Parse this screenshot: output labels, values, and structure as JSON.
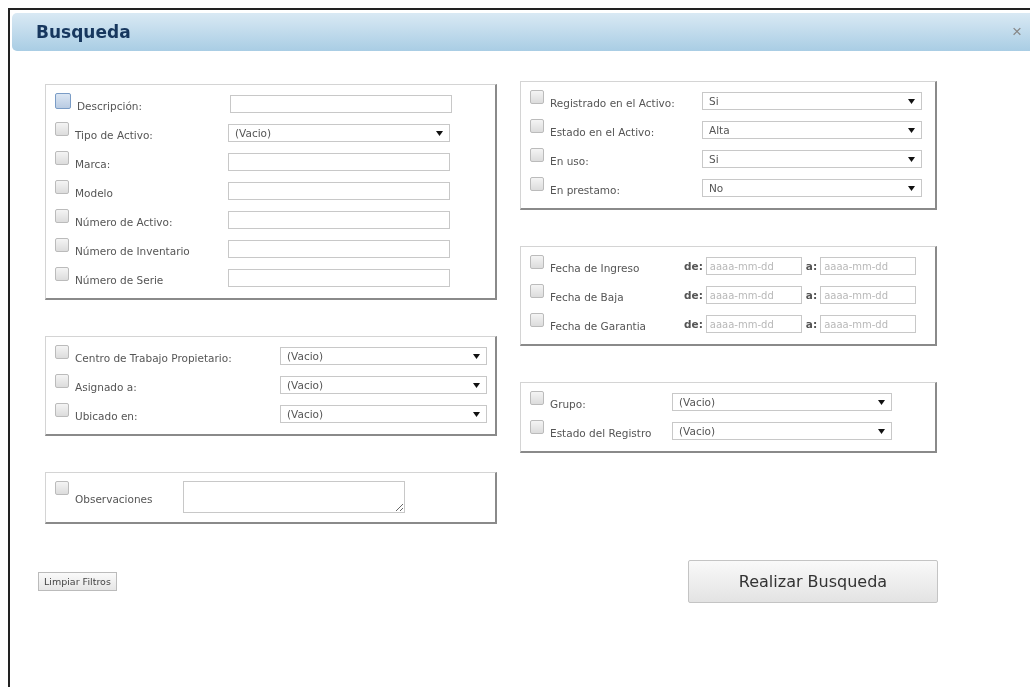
{
  "dialog": {
    "title": "Busqueda",
    "close": "×"
  },
  "columns": [
    {
      "panels": [
        {
          "rows": [
            {
              "kind": "text",
              "label": "Descripción:",
              "checked": false,
              "focused": true
            },
            {
              "kind": "select",
              "label": "Tipo de Activo:",
              "value": "(Vacio)",
              "checked": false,
              "focused": false
            },
            {
              "kind": "text",
              "label": "Marca:",
              "checked": false,
              "focused": false
            },
            {
              "kind": "text",
              "label": "Modelo",
              "checked": false,
              "focused": false
            },
            {
              "kind": "text",
              "label": "Número de Activo:",
              "checked": false,
              "focused": false
            },
            {
              "kind": "text",
              "label": "Número de Inventario",
              "checked": false,
              "focused": false
            },
            {
              "kind": "text",
              "label": "Número de Serie",
              "checked": false,
              "focused": false
            }
          ]
        },
        {
          "rows": [
            {
              "kind": "select",
              "label": "Centro de Trabajo Propietario:",
              "value": "(Vacio)",
              "checked": false,
              "focused": false
            },
            {
              "kind": "select",
              "label": "Asignado a:",
              "value": "(Vacio)",
              "checked": false,
              "focused": false
            },
            {
              "kind": "select",
              "label": "Ubicado en:",
              "value": "(Vacio)",
              "checked": false,
              "focused": false
            }
          ]
        },
        {
          "rows": [
            {
              "kind": "textarea",
              "label": "Observaciones",
              "checked": false,
              "focused": false
            }
          ]
        }
      ]
    },
    {
      "panels": [
        {
          "rows": [
            {
              "kind": "select",
              "label": "Registrado en el Activo:",
              "value": "Si",
              "checked": false,
              "focused": false
            },
            {
              "kind": "select",
              "label": "Estado en el Activo:",
              "value": "Alta",
              "checked": false,
              "focused": false
            },
            {
              "kind": "select",
              "label": "En uso:",
              "value": "Si",
              "checked": false,
              "focused": false
            },
            {
              "kind": "select",
              "label": "En prestamo:",
              "value": "No",
              "checked": false,
              "focused": false
            }
          ]
        },
        {
          "rows": [
            {
              "kind": "date-range",
              "label": "Fecha de Ingreso",
              "from_label": "de:",
              "from_placeholder": "aaaa-mm-dd",
              "to_label": "a:",
              "to_placeholder": "aaaa-mm-dd",
              "checked": false,
              "focused": false
            },
            {
              "kind": "date-range",
              "label": "Fecha de Baja",
              "from_label": "de:",
              "from_placeholder": "aaaa-mm-dd",
              "to_label": "a:",
              "to_placeholder": "aaaa-mm-dd",
              "checked": false,
              "focused": false
            },
            {
              "kind": "date-range",
              "label": "Fecha de Garantia",
              "from_label": "de:",
              "from_placeholder": "aaaa-mm-dd",
              "to_label": "a:",
              "to_placeholder": "aaaa-mm-dd",
              "checked": false,
              "focused": false
            }
          ]
        },
        {
          "rows": [
            {
              "kind": "select",
              "label": "Grupo:",
              "value": "(Vacio)",
              "checked": false,
              "focused": false
            },
            {
              "kind": "select",
              "label": "Estado del Registro",
              "value": "(Vacio)",
              "checked": false,
              "focused": false
            }
          ]
        }
      ]
    }
  ],
  "buttons": [
    {
      "kind": "small",
      "label": "Limpiar Filtros"
    },
    {
      "kind": "large",
      "label": "Realizar Busqueda"
    }
  ]
}
